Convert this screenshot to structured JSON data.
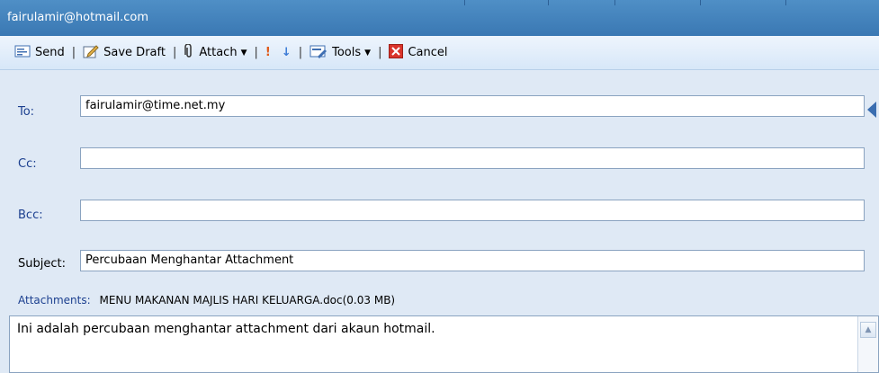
{
  "window": {
    "title": "fairulamir@hotmail.com"
  },
  "toolbar": {
    "send_label": "Send",
    "save_draft_label": "Save Draft",
    "attach_label": "Attach",
    "tools_label": "Tools",
    "cancel_label": "Cancel",
    "separator": "|"
  },
  "form": {
    "to_label": "To:",
    "to_value": "fairulamir@time.net.my",
    "cc_label": "Cc:",
    "cc_value": "",
    "bcc_label": "Bcc:",
    "bcc_value": "",
    "subject_label": "Subject:",
    "subject_value": "Percubaan Menghantar Attachment"
  },
  "attachments": {
    "label": "Attachments:",
    "file": "MENU MAKANAN MAJLIS HARI KELUARGA.doc(0.03 MB)"
  },
  "message": {
    "body": "Ini adalah percubaan menghantar attachment dari akaun hotmail."
  },
  "colors": {
    "titlebar": "#3a78b3",
    "form_background": "#dfe9f5",
    "label_blue": "#1b3f8f",
    "cancel_red": "#d9342b"
  }
}
